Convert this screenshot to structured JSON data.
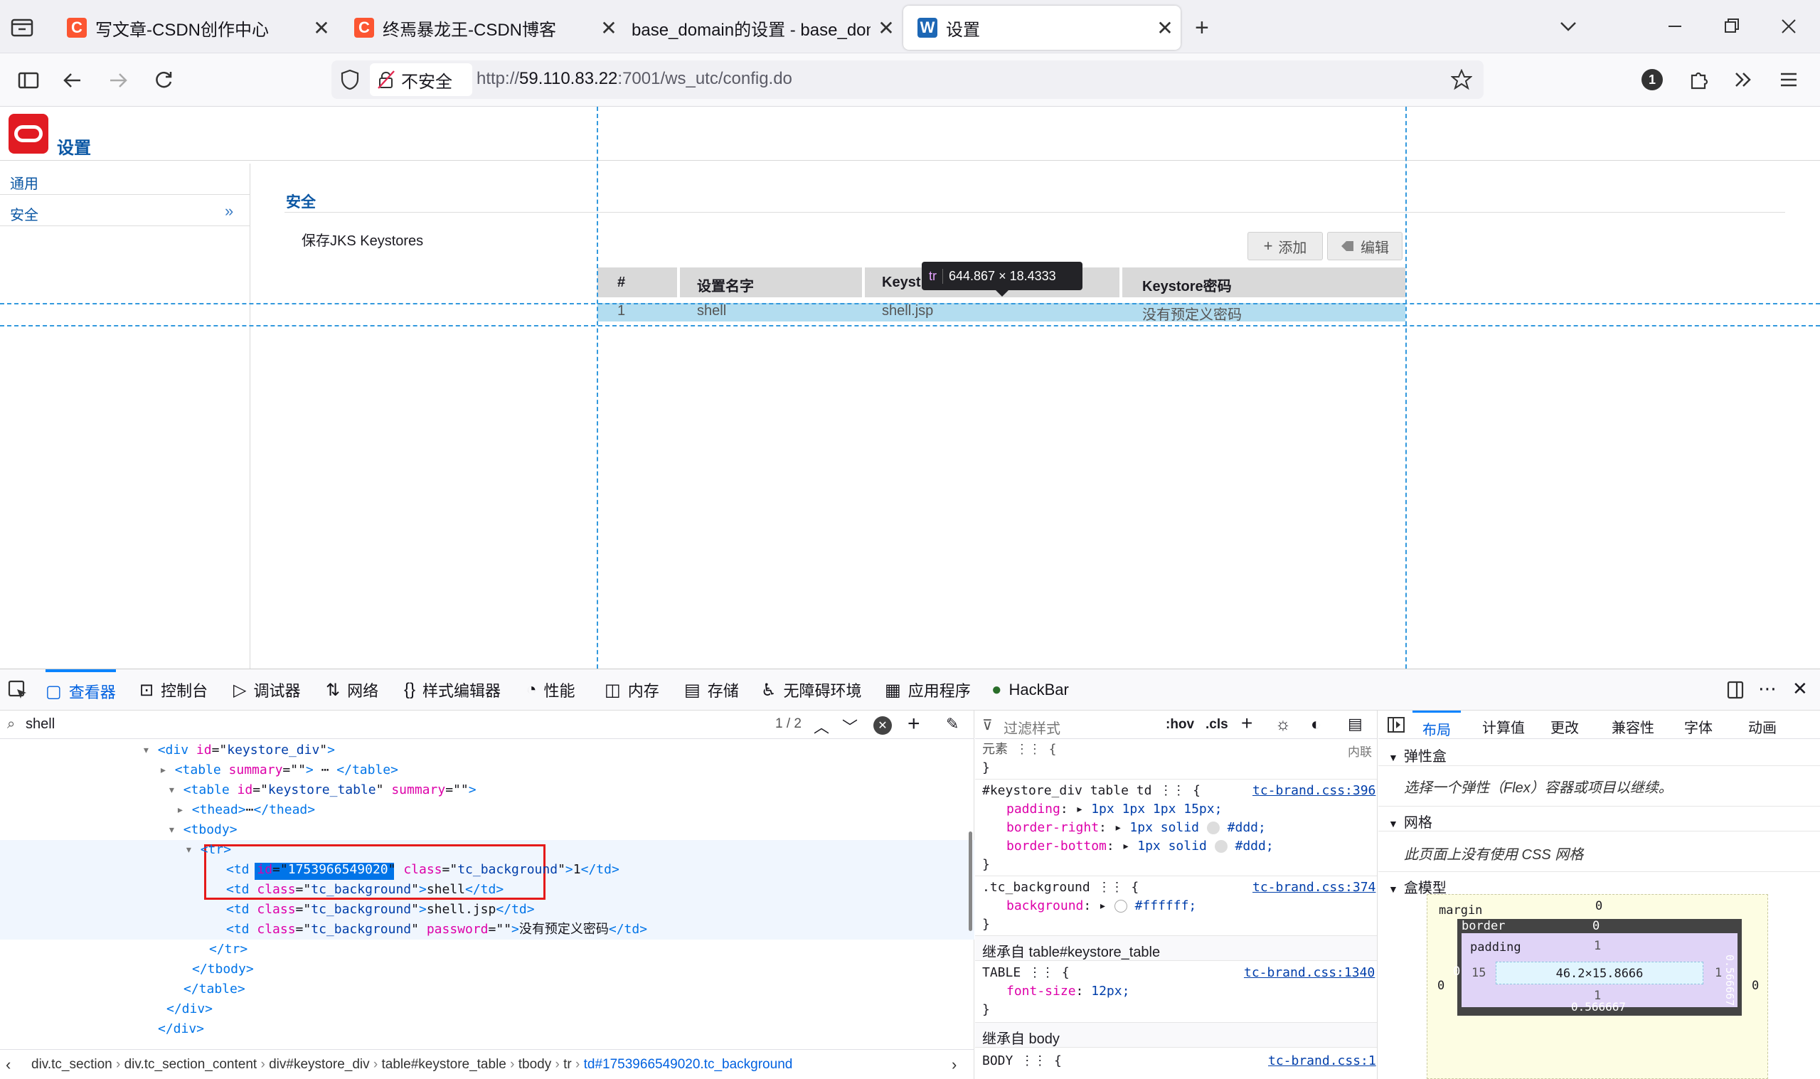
{
  "tabs": [
    {
      "title": "写文章-CSDN创作中心",
      "favicon": "C",
      "fav_color": "#fc5531"
    },
    {
      "title": "终焉暴龙王-CSDN博客",
      "favicon": "C",
      "fav_color": "#fc5531"
    },
    {
      "title": "base_domain的设置 - base_doma"
    },
    {
      "title": "设置",
      "favicon": "W",
      "fav_color": "#1d67b5"
    }
  ],
  "nav": {
    "security_label": "不安全",
    "url_prefix": "http://",
    "url_host": "59.110.83.22",
    "url_rest": ":7001/ws_utc/config.do",
    "badge_count": "1"
  },
  "app": {
    "title": "设置",
    "sidebar": [
      {
        "label": "通用"
      },
      {
        "label": "安全"
      }
    ],
    "section_title": "安全",
    "subsection": "保存JKS Keystores",
    "add_label": "添加",
    "edit_label": "编辑",
    "table": {
      "headers": [
        "#",
        "设置名字",
        "Keyst",
        "Keystore密码"
      ],
      "row": [
        "1",
        "shell",
        "shell.jsp",
        "没有预定义密码"
      ]
    },
    "tooltip": {
      "tag": "tr",
      "size": "644.867 × 18.4333"
    }
  },
  "devtools": {
    "tabs": [
      "查看器",
      "控制台",
      "调试器",
      "网络",
      "样式编辑器",
      "性能",
      "内存",
      "存储",
      "无障碍环境",
      "应用程序",
      "HackBar"
    ],
    "search_value": "shell",
    "match_count": "1 / 2",
    "html_lines": [
      {
        "parts": [
          [
            "tg",
            "<div "
          ],
          [
            "an",
            "id"
          ],
          [
            "tx",
            "=\""
          ],
          [
            "av",
            "keystore_div"
          ],
          [
            "tx",
            "\""
          ],
          [
            "tg",
            ">"
          ]
        ]
      },
      {
        "parts": [
          [
            "tg",
            "<table "
          ],
          [
            "an",
            "summary"
          ],
          [
            "tx",
            "=\"\""
          ],
          [
            "tg",
            ">"
          ],
          [
            "tx",
            " ⋯ "
          ],
          [
            "tg",
            "</table>"
          ]
        ]
      },
      {
        "parts": [
          [
            "tg",
            "<table "
          ],
          [
            "an",
            "id"
          ],
          [
            "tx",
            "=\""
          ],
          [
            "av",
            "keystore_table"
          ],
          [
            "tx",
            "\" "
          ],
          [
            "an",
            "summary"
          ],
          [
            "tx",
            "=\"\""
          ],
          [
            "tg",
            ">"
          ]
        ]
      },
      {
        "parts": [
          [
            "tg",
            "<thead>"
          ],
          [
            "tx",
            "⋯"
          ],
          [
            "tg",
            "</thead>"
          ]
        ]
      },
      {
        "parts": [
          [
            "tg",
            "<tbody>"
          ]
        ]
      },
      {
        "parts": [
          [
            "tg",
            "<tr>"
          ]
        ]
      },
      {
        "parts": [
          [
            "tg",
            "<td "
          ],
          [
            "an",
            "id"
          ],
          [
            "tx",
            "=\""
          ],
          [
            "av",
            "1753966549020"
          ],
          [
            "tx",
            "\" "
          ],
          [
            "an",
            "class"
          ],
          [
            "tx",
            "=\""
          ],
          [
            "av",
            "tc_background"
          ],
          [
            "tx",
            "\""
          ],
          [
            "tg",
            ">"
          ],
          [
            "tx",
            "1"
          ],
          [
            "tg",
            "</td>"
          ]
        ]
      },
      {
        "parts": [
          [
            "tg",
            "<td "
          ],
          [
            "an",
            "class"
          ],
          [
            "tx",
            "=\""
          ],
          [
            "av",
            "tc_background"
          ],
          [
            "tx",
            "\""
          ],
          [
            "tg",
            ">"
          ],
          [
            "tx",
            "shell"
          ],
          [
            "tg",
            "</td>"
          ]
        ]
      },
      {
        "parts": [
          [
            "tg",
            "<td "
          ],
          [
            "an",
            "class"
          ],
          [
            "tx",
            "=\""
          ],
          [
            "av",
            "tc_background"
          ],
          [
            "tx",
            "\""
          ],
          [
            "tg",
            ">"
          ],
          [
            "tx",
            "shell.jsp"
          ],
          [
            "tg",
            "</td>"
          ]
        ]
      },
      {
        "parts": [
          [
            "tg",
            "<td "
          ],
          [
            "an",
            "class"
          ],
          [
            "tx",
            "=\""
          ],
          [
            "av",
            "tc_background"
          ],
          [
            "tx",
            "\" "
          ],
          [
            "an",
            "password"
          ],
          [
            "tx",
            "=\"\""
          ],
          [
            "tg",
            ">"
          ],
          [
            "tx",
            "没有预定义密码"
          ],
          [
            "tg",
            "</td>"
          ]
        ]
      },
      {
        "parts": [
          [
            "tg",
            "</tr>"
          ]
        ]
      },
      {
        "parts": [
          [
            "tg",
            "</tbody>"
          ]
        ]
      },
      {
        "parts": [
          [
            "tg",
            "</table>"
          ]
        ]
      },
      {
        "parts": [
          [
            "tg",
            "</div>"
          ]
        ]
      },
      {
        "parts": [
          [
            "tg",
            "</div>"
          ]
        ]
      }
    ],
    "breadcrumbs": [
      "div.tc_section",
      "div.tc_section_content",
      "div#keystore_div",
      "table#keystore_table",
      "tbody",
      "tr",
      "td#1753966549020.tc_background"
    ],
    "styles": {
      "filter_placeholder": "过滤样式",
      "hov": ":hov",
      "cls": ".cls",
      "element_label": "元素",
      "inline_label": "内联",
      "rule1_selector": "#keystore_div table td",
      "rule1_src": "tc-brand.css:396",
      "rule1_props": [
        [
          "padding",
          "1px 1px 1px 15px;"
        ],
        [
          "border-right",
          "1px solid",
          "#ddd;"
        ],
        [
          "border-bottom",
          "1px solid",
          "#ddd;"
        ]
      ],
      "rule2_selector": ".tc_background",
      "rule2_src": "tc-brand.css:374",
      "rule2_prop": "background",
      "rule2_val": "#ffffff;",
      "inherit1": "继承自 table#keystore_table",
      "rule3_selector": "TABLE",
      "rule3_src": "tc-brand.css:1340",
      "rule3_prop": "font-size",
      "rule3_val": "12px;",
      "inherit2": "继承自 body",
      "rule4_selector": "BODY",
      "rule4_src": "tc-brand.css:1"
    },
    "layout": {
      "tabs": [
        "布局",
        "计算值",
        "更改",
        "兼容性",
        "字体",
        "动画"
      ],
      "flex_title": "弹性盒",
      "flex_msg": "选择一个弹性（Flex）容器或项目以继续。",
      "grid_title": "网格",
      "grid_msg": "此页面上没有使用 CSS 网格",
      "box_title": "盒模型",
      "box": {
        "margin_label": "margin",
        "border_label": "border",
        "padding_label": "padding",
        "content": "46.2×15.8666",
        "m_top": "0",
        "m_left": "0",
        "m_right": "0",
        "b_top": "0",
        "b_left": "0",
        "b_right": "0.566667",
        "b_bottom": "0.566667",
        "p_top": "1",
        "p_left": "15",
        "p_right": "1",
        "p_bottom": "1"
      }
    }
  }
}
